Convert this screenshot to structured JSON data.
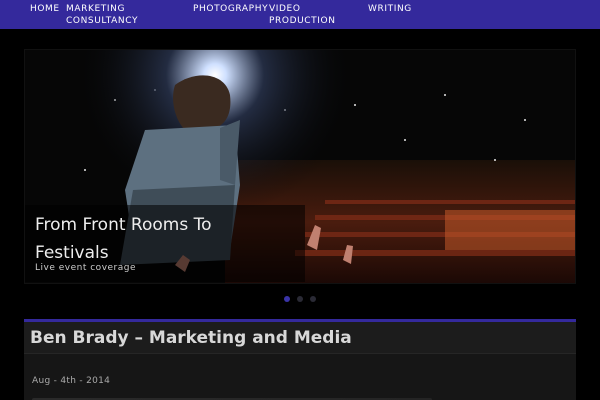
{
  "nav": {
    "items": [
      {
        "label_line1": "HOME",
        "label_line2": ""
      },
      {
        "label_line1": "MARKETING",
        "label_line2": "CONSULTANCY"
      },
      {
        "label_line1": "PHOTOGRAPHY",
        "label_line2": ""
      },
      {
        "label_line1": "VIDEO",
        "label_line2": "PRODUCTION"
      },
      {
        "label_line1": "WRITING",
        "label_line2": ""
      }
    ]
  },
  "slider": {
    "caption_title": "From Front Rooms To Festivals",
    "caption_subtitle": "Live event coverage",
    "slide_count": 3,
    "active_index": 0
  },
  "content": {
    "title": "Ben Brady – Marketing and Media",
    "date": "Aug - 4th - 2014"
  },
  "colors": {
    "nav_bg": "#34299c",
    "accent": "#3a34a8"
  }
}
